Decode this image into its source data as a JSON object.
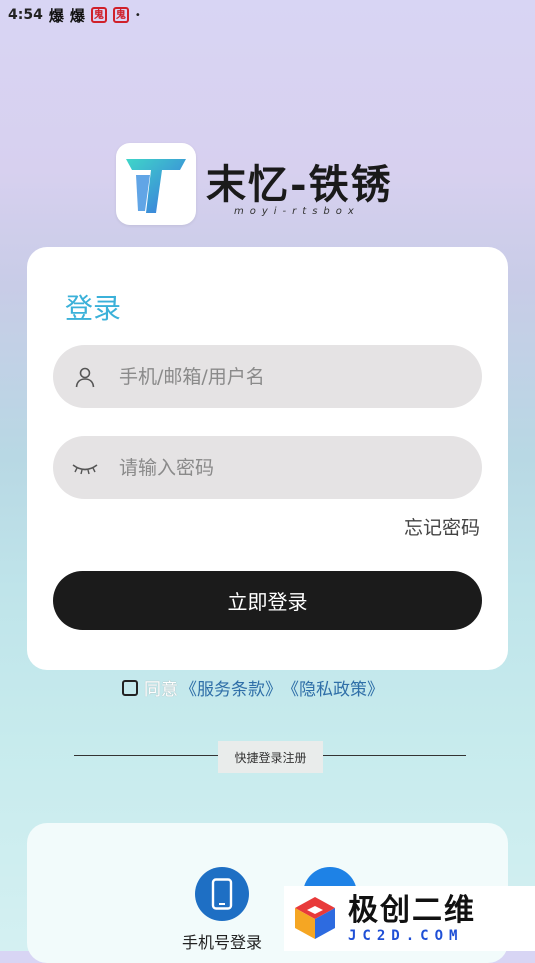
{
  "status_bar": {
    "time": "4:54",
    "icon1": "爆",
    "icon2": "爆",
    "badge1": "鬼",
    "badge2": "鬼",
    "dot": "•"
  },
  "brand": {
    "title": "末忆-铁锈",
    "subtitle": "moyi-rtsbox"
  },
  "login": {
    "title": "登录",
    "username_placeholder": "手机/邮箱/用户名",
    "password_placeholder": "请输入密码",
    "forgot_label": "忘记密码",
    "submit_label": "立即登录"
  },
  "agreement": {
    "prefix": "同意",
    "terms_label": "《服务条款》",
    "privacy_label": "《隐私政策》",
    "checked": false
  },
  "quick": {
    "divider_label": "快捷登录注册",
    "phone_label": "手机号登录"
  },
  "watermark": {
    "cn": "极创二维",
    "en": "JC2D.COM"
  },
  "colors": {
    "accent": "#3bb1d9",
    "button": "#1b1b1b",
    "link": "#2f6fa8",
    "phone_icon_bg": "#1e6fc4"
  }
}
